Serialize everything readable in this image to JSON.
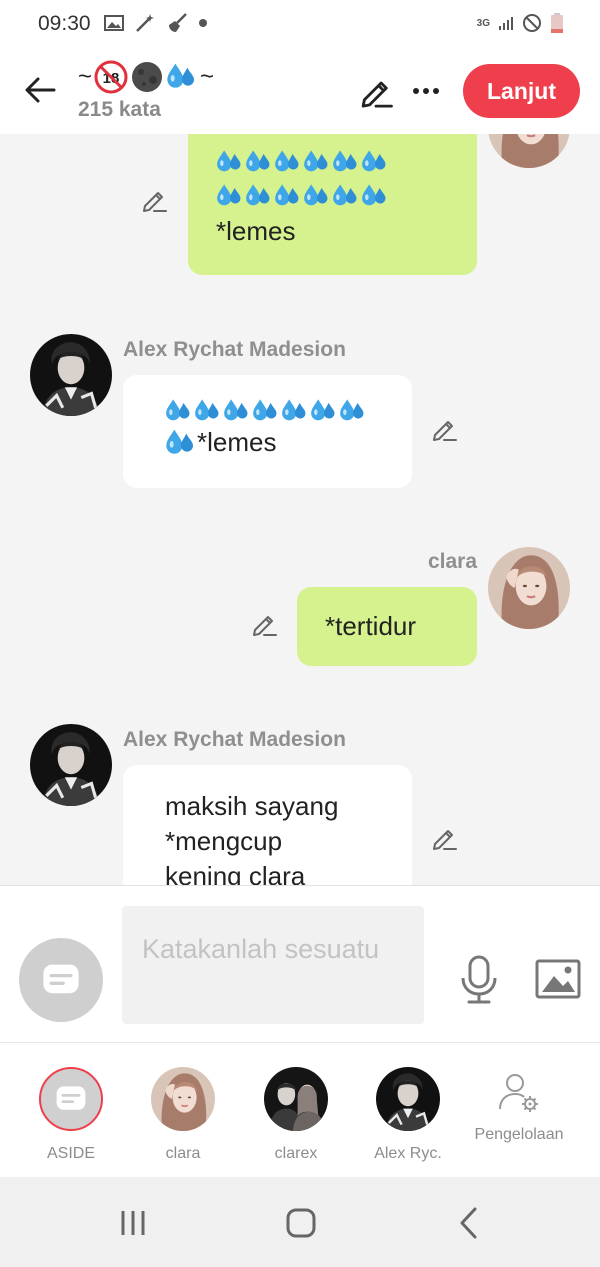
{
  "status_bar": {
    "time": "09:30",
    "network": "3G"
  },
  "header": {
    "title_prefix": "~",
    "title_suffix": "~",
    "word_count": "215 kata",
    "continue_label": "Lanjut"
  },
  "messages": [
    {
      "side": "right",
      "sender": "",
      "text": "*lemes",
      "color": "#d6f28e"
    },
    {
      "side": "left",
      "sender": "Alex Rychat Madesion",
      "text": "*lemes",
      "color": "#ffffff"
    },
    {
      "side": "right",
      "sender": "clara",
      "text": "*tertidur",
      "color": "#d6f28e"
    },
    {
      "side": "left",
      "sender": "Alex Rychat Madesion",
      "text_lines": [
        "maksih sayang",
        "*mengcup",
        "kening clara"
      ],
      "color": "#ffffff"
    }
  ],
  "input": {
    "placeholder": "Katakanlah sesuatu"
  },
  "characters": [
    {
      "label": "ASIDE"
    },
    {
      "label": "clara"
    },
    {
      "label": "clarex"
    },
    {
      "label": "Alex Ryc."
    },
    {
      "label": "Pengelolaan"
    }
  ],
  "colors": {
    "accent": "#ef3f4c",
    "bubble_user": "#d6f28e",
    "bubble_other": "#ffffff"
  }
}
